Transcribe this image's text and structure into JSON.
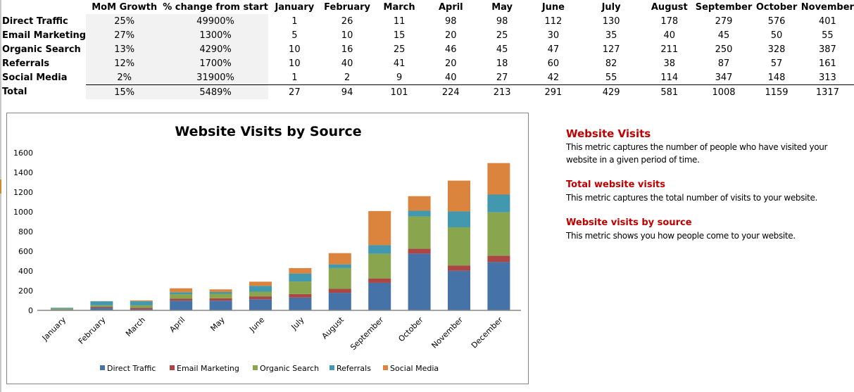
{
  "table": {
    "headers": [
      "",
      "MoM Growth",
      "% change from start",
      "January",
      "February",
      "March",
      "April",
      "May",
      "June",
      "July",
      "August",
      "September",
      "October",
      "November"
    ],
    "rows": [
      {
        "label": "Direct Traffic",
        "mom": "25%",
        "change": "49900%",
        "values": [
          "1",
          "26",
          "11",
          "98",
          "98",
          "112",
          "130",
          "178",
          "279",
          "576",
          "401"
        ]
      },
      {
        "label": "Email Marketing",
        "mom": "27%",
        "change": "1300%",
        "values": [
          "5",
          "10",
          "15",
          "20",
          "25",
          "30",
          "35",
          "40",
          "45",
          "50",
          "55"
        ]
      },
      {
        "label": "Organic Search",
        "mom": "13%",
        "change": "4290%",
        "values": [
          "10",
          "16",
          "25",
          "46",
          "45",
          "47",
          "127",
          "211",
          "250",
          "328",
          "387"
        ]
      },
      {
        "label": "Referrals",
        "mom": "12%",
        "change": "1700%",
        "values": [
          "10",
          "40",
          "41",
          "20",
          "18",
          "60",
          "82",
          "38",
          "87",
          "57",
          "161"
        ]
      },
      {
        "label": "Social Media",
        "mom": "2%",
        "change": "31900%",
        "values": [
          "1",
          "2",
          "9",
          "40",
          "27",
          "42",
          "55",
          "114",
          "347",
          "148",
          "313"
        ]
      }
    ],
    "total": {
      "label": "Total",
      "mom": "15%",
      "change": "5489%",
      "values": [
        "27",
        "94",
        "101",
        "224",
        "213",
        "291",
        "429",
        "581",
        "1008",
        "1159",
        "1317"
      ]
    }
  },
  "chart_data": {
    "type": "bar",
    "stacked": true,
    "title": "Website Visits by Source",
    "xlabel": "",
    "ylabel": "",
    "ylim": [
      0,
      1600
    ],
    "yticks": [
      0,
      200,
      400,
      600,
      800,
      1000,
      1200,
      1400,
      1600
    ],
    "grid": false,
    "legend_position": "bottom",
    "categories": [
      "January",
      "February",
      "March",
      "April",
      "May",
      "June",
      "July",
      "August",
      "September",
      "October",
      "November",
      "December"
    ],
    "series": [
      {
        "name": "Direct Traffic",
        "color": "#4572a7",
        "values": [
          1,
          26,
          11,
          98,
          98,
          112,
          130,
          178,
          279,
          576,
          401,
          490
        ]
      },
      {
        "name": "Email Marketing",
        "color": "#aa4643",
        "values": [
          5,
          10,
          15,
          20,
          25,
          30,
          35,
          40,
          45,
          50,
          55,
          65
        ]
      },
      {
        "name": "Organic Search",
        "color": "#89a54e",
        "values": [
          10,
          16,
          25,
          46,
          45,
          47,
          127,
          211,
          250,
          328,
          387,
          440
        ]
      },
      {
        "name": "Referrals",
        "color": "#4198af",
        "values": [
          10,
          40,
          41,
          20,
          18,
          60,
          82,
          38,
          87,
          57,
          161,
          180
        ]
      },
      {
        "name": "Social Media",
        "color": "#db843d",
        "values": [
          1,
          2,
          9,
          40,
          27,
          42,
          55,
          114,
          347,
          148,
          313,
          320
        ]
      }
    ]
  },
  "notes": {
    "title": "Website Visits",
    "title_text": "This metric captures the number of people who have visited your website in a given period of time.",
    "sections": [
      {
        "heading": "Total website visits",
        "text": "This metric captures the total number of visits to your website."
      },
      {
        "heading": "Website visits by source",
        "text": "This metric shows you how people come to your website."
      }
    ]
  }
}
